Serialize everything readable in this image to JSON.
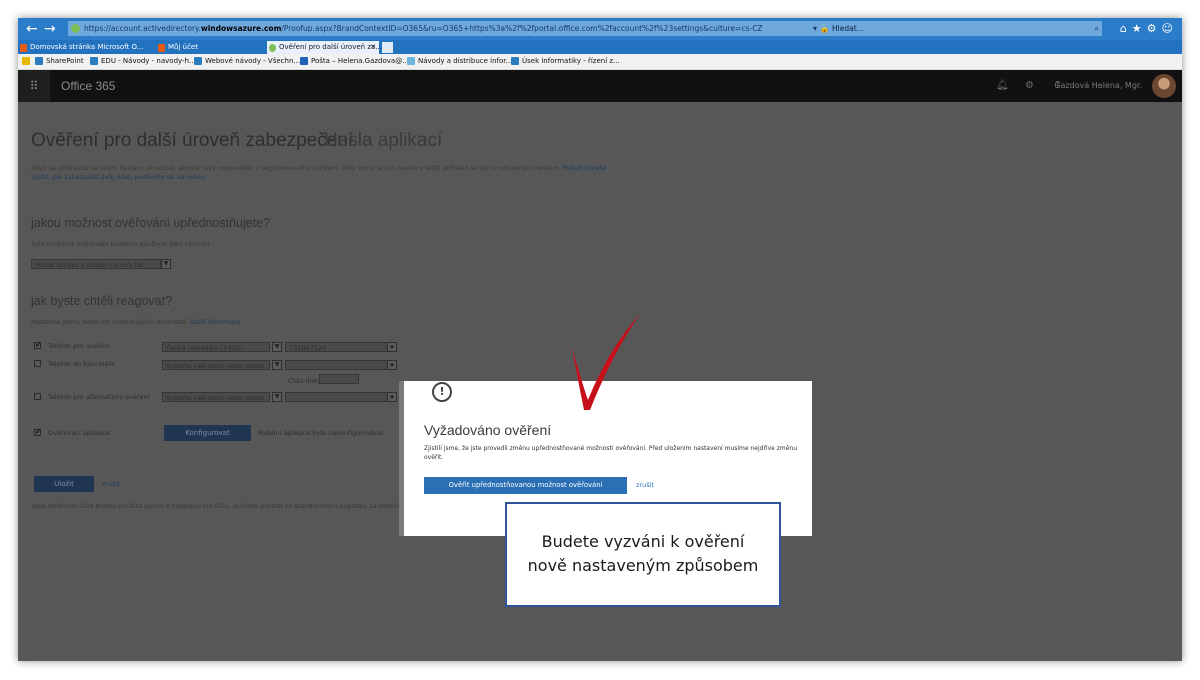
{
  "browser": {
    "url_prefix": "https://account.activedirectory.",
    "url_domain": "windowsazure.com",
    "url_rest": "/Proofup.aspx?BrandContextID=O365&ru=O365+https%3a%2f%2fportal.office.com%2faccount%2f%23settings&culture=cs-CZ",
    "search_placeholder": "Hledat...",
    "tabs": [
      {
        "label": "Domovská stránka Microsoft O..."
      },
      {
        "label": "Můj účet"
      },
      {
        "label": "Ověření pro další úroveň za..."
      }
    ],
    "favorites": [
      {
        "label": "SharePoint"
      },
      {
        "label": "EDU - Návody - navody-h..."
      },
      {
        "label": "Webové návody - Všechn..."
      },
      {
        "label": "Pošta – Helena.Gazdova@..."
      },
      {
        "label": "Návody a distribuce infor..."
      },
      {
        "label": "Úsek informatiky - řízení z..."
      }
    ]
  },
  "header": {
    "app_title": "Office 365",
    "user_name": "Gazdová Helena, Mgr."
  },
  "page": {
    "title": "Ověření pro další úroveň zabezpečení",
    "tab_app_passwords": "Hesla aplikací",
    "intro_text": "Když se přihlásíte se svým heslem, je nutné, abyste taky odpověděli z registrovaného zařízení. Díky tomu je pro hackery těžší přihlásit se jen s odcizeným heslem.",
    "intro_link": "Pokud chcete zjistit, jak zabezpečit svůj účet, podívejte se na video.",
    "q1_heading": "jakou možnost ověřování upřednostňujete?",
    "q1_sub": "Tuto možnost ověřování budeme používat jako výchozí.",
    "q1_select": "Poslat zprávu s kódem na můj tel",
    "q2_heading": "jak byste chtěli reagovat?",
    "q2_sub": "Nastavte jednu nebo víc následujících možností.",
    "q2_link": "Další informace",
    "rows": [
      {
        "label": "Telefon pro ověření",
        "country": "Česká republika (+420)",
        "value": "731907125",
        "checked": "✔"
      },
      {
        "label": "Telefon do kanceláře",
        "country": "Vyberte vaši zemi nebo oblast",
        "value": "",
        "checked": ""
      },
      {
        "label": "Telefon pro alternativní ověření",
        "country": "Vyberte vaši zemi nebo oblast",
        "value": "",
        "checked": ""
      }
    ],
    "extension_label": "Číslo linky",
    "app_label": "Ověřovací aplikace",
    "app_checked": "✔",
    "configure_label": "Konfigurovat",
    "app_status": "Mobilní aplikace byla nakonfigurována.",
    "save_label": "Uložit",
    "cancel_label": "zrušit",
    "footnote": "Vaše telefonní čísla budou použita pouze k zabezpečení účtu. Je třeba počítat se standardními poplatky za telefonní hovory a zprávy SMS."
  },
  "modal": {
    "warn_glyph": "!",
    "title": "Vyžadováno ověření",
    "text": "Zjistili jsme, že jste provedli změnu upřednostňované možnosti ověřování. Před uložením nastavení musíme nejdříve změnu ověřit.",
    "verify_button": "Ověřit upřednostňovanou možnost ověřování",
    "cancel": "zrušit"
  },
  "callout": {
    "line1": "Budete vyzváni k ověření",
    "line2": "nově nastaveným způsobem"
  },
  "colors": {
    "annotation_arrow": "#c8101a",
    "callout_border": "#2f5597",
    "primary_button": "#2b6fb5"
  }
}
